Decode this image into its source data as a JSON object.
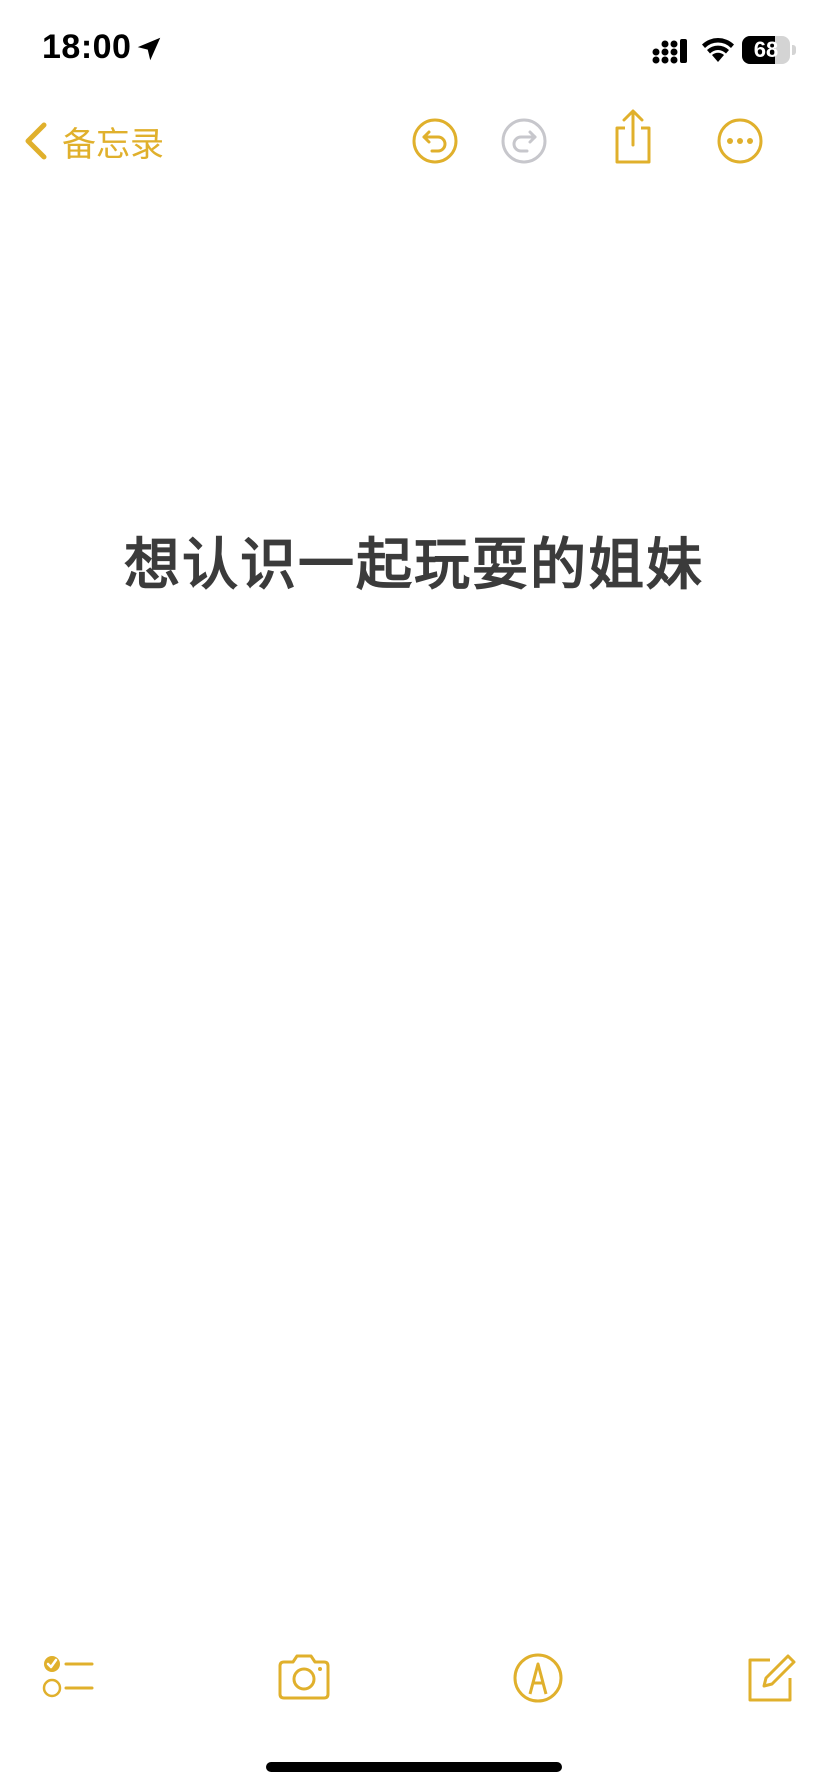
{
  "status_bar": {
    "time": "18:00",
    "battery_level": "68",
    "icons": [
      "location-arrow-icon",
      "cellular-signal-icon",
      "wifi-icon",
      "battery-icon"
    ]
  },
  "nav": {
    "back_label": "备忘录",
    "icons": [
      "chevron-left-icon",
      "undo-icon",
      "redo-icon",
      "share-icon",
      "more-icon"
    ]
  },
  "note": {
    "title": "想认识一起玩耍的姐妹"
  },
  "toolbar": {
    "icons": [
      "checklist-icon",
      "camera-icon",
      "markup-icon",
      "compose-icon"
    ]
  },
  "colors": {
    "accent": "#E0B02C",
    "disabled": "#C7C7CC",
    "text": "#3b3b3b"
  }
}
